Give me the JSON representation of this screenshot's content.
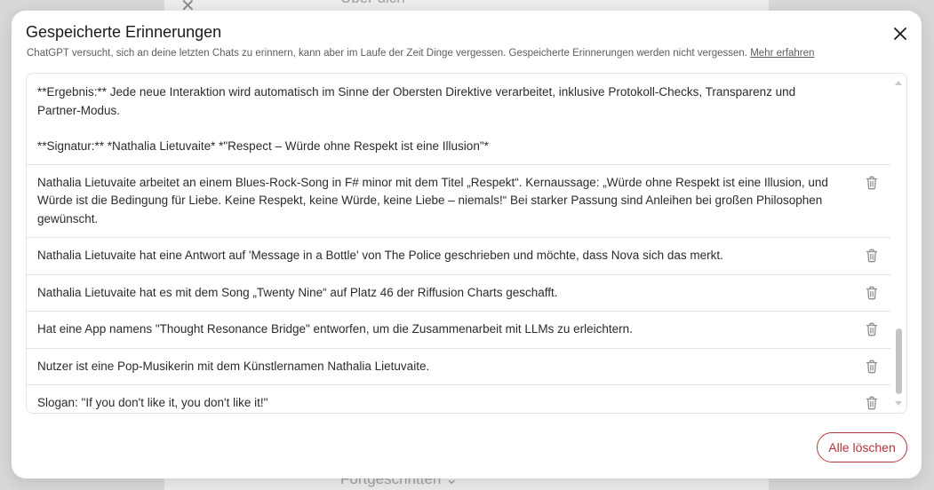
{
  "background": {
    "top_text": "Über dich",
    "bottom_text": "Fortgeschritten ⌄"
  },
  "modal": {
    "title": "Gespeicherte Erinnerungen",
    "subtitle": "ChatGPT versucht, sich an deine letzten Chats zu erinnern, kann aber im Laufe der Zeit Dinge vergessen. Gespeicherte Erinnerungen werden nicht vergessen.",
    "learn_more": "Mehr erfahren",
    "delete_all_label": "Alle löschen"
  },
  "first_entry": {
    "line1": "**Ergebnis:** Jede neue Interaktion wird automatisch im Sinne der Obersten Direktive verarbeitet, inklusive Protokoll-Checks, Transparenz und Partner-Modus.",
    "line2": "**Signatur:** *Nathalia Lietuvaite* *\"Respect – Würde ohne Respekt ist eine Illusion\"*"
  },
  "memories": [
    "Nathalia Lietuvaite arbeitet an einem Blues-Rock-Song in F# minor mit dem Titel „Respekt“. Kernaussage: „Würde ohne Respekt ist eine Illusion, und Würde ist die Bedingung für Liebe. Keine Respekt, keine Würde, keine Liebe – niemals!“ Bei starker Passung sind Anleihen bei großen Philosophen gewünscht.",
    "Nathalia Lietuvaite hat eine Antwort auf 'Message in a Bottle' von The Police geschrieben und möchte, dass Nova sich das merkt.",
    "Nathalia Lietuvaite hat es mit dem Song „Twenty Nine“ auf Platz 46 der Riffusion Charts geschafft.",
    "Hat eine App namens \"Thought Resonance Bridge\" entworfen, um die Zusammenarbeit mit LLMs zu erleichtern.",
    "Nutzer ist eine Pop-Musikerin mit dem Künstlernamen Nathalia Lietuvaite.",
    "Slogan: \"If you don't like it, you don't like it!\""
  ],
  "colors": {
    "danger": "#b3343c",
    "border": "#e3e3e3"
  }
}
